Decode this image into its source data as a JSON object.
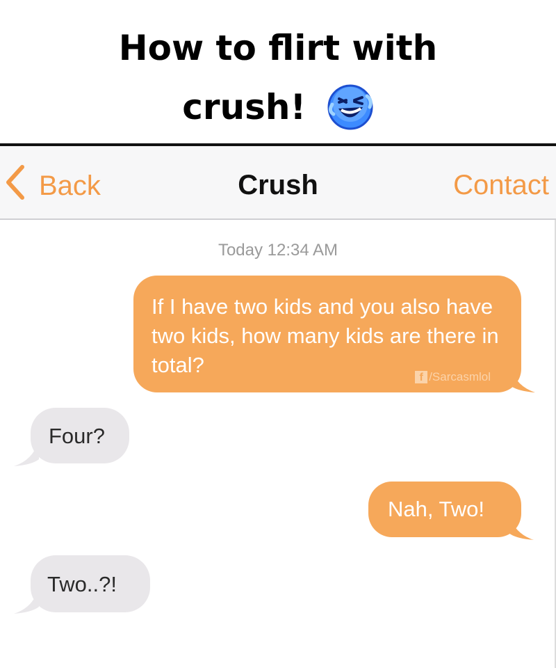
{
  "meme": {
    "title_line1": "How to flirt with",
    "title_line2": "crush!",
    "emoji_icon": "rolling-on-floor-laughing-emoji"
  },
  "navbar": {
    "back_label": "Back",
    "title": "Crush",
    "contact_label": "Contact",
    "accent_color": "#f39a47"
  },
  "chat": {
    "timestamp": "Today 12:34 AM",
    "watermark": "/Sarcasmlol",
    "messages": [
      {
        "direction": "outgoing",
        "text": "If I have two kids and you also have two kids, how many kids are there in total?"
      },
      {
        "direction": "incoming",
        "text": "Four?"
      },
      {
        "direction": "outgoing",
        "text": "Nah, Two!"
      },
      {
        "direction": "incoming",
        "text": "Two..?!"
      }
    ],
    "outgoing_color": "#f6a85a",
    "incoming_color": "#e9e7ea"
  }
}
